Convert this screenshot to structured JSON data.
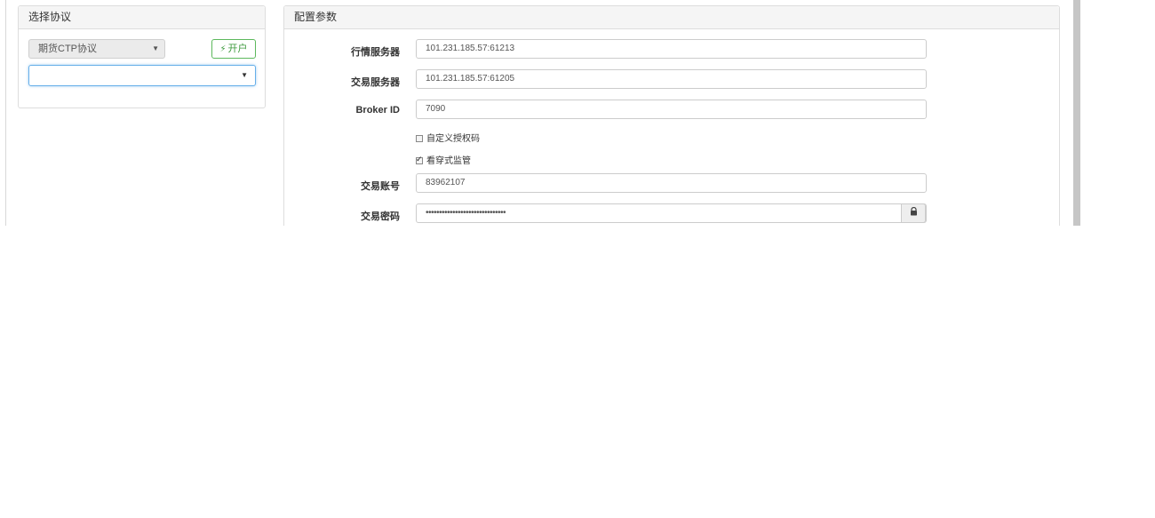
{
  "left_panel": {
    "title": "选择协议",
    "protocol_select": {
      "selected": "期货CTP协议"
    },
    "open_button": {
      "icon": "bolt-icon",
      "label": "开户"
    },
    "account_select": {
      "selected": ""
    }
  },
  "right_panel": {
    "title": "配置参数",
    "fields": {
      "market_server": {
        "label": "行情服务器",
        "value": "101.231.185.57:61213"
      },
      "trade_server": {
        "label": "交易服务器",
        "value": "101.231.185.57:61205"
      },
      "broker_id": {
        "label": "Broker ID",
        "value": "7090"
      },
      "custom_auth": {
        "label": "自定义授权码",
        "checked": false
      },
      "see_through": {
        "label": "看穿式监管",
        "checked": true
      },
      "account": {
        "label": "交易账号",
        "value": "83962107"
      },
      "password": {
        "label": "交易密码",
        "value": "••••••••••••••••••••••••••••••",
        "icon": "lock-icon"
      }
    }
  },
  "colors": {
    "panel_border": "#dddddd",
    "panel_heading_bg": "#f5f5f5",
    "success": "#5cb85c",
    "focus": "#66afe9"
  }
}
